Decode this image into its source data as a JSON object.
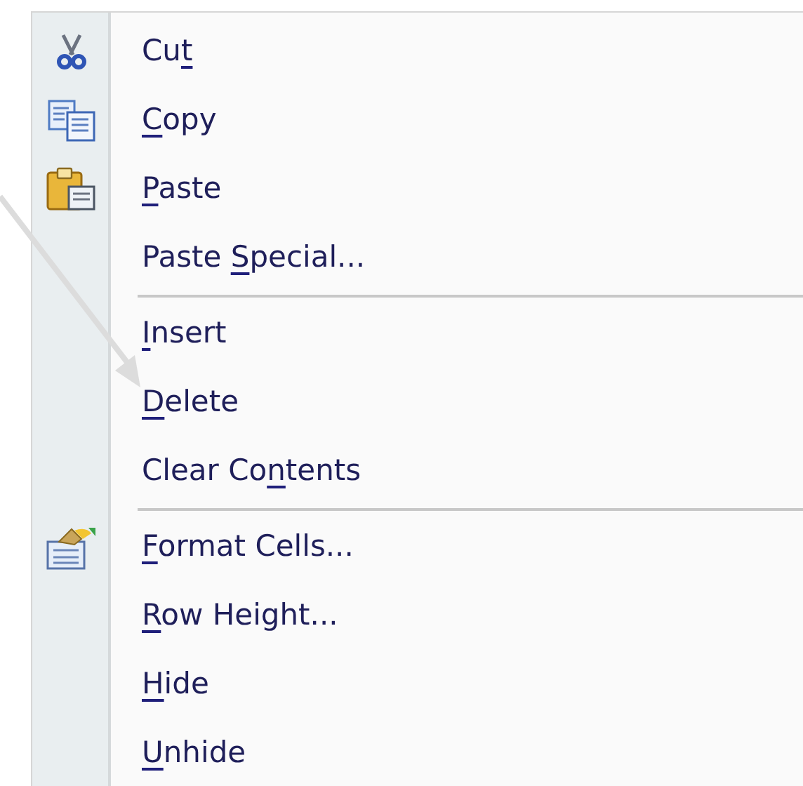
{
  "menu": {
    "items": [
      {
        "kind": "item",
        "pre": "Cu",
        "key": "t"
      },
      {
        "kind": "item",
        "key": "C",
        "post": "opy"
      },
      {
        "kind": "item",
        "key": "P",
        "post": "aste"
      },
      {
        "kind": "item",
        "pre": "Paste ",
        "key": "S",
        "post": "pecial..."
      },
      {
        "kind": "separator"
      },
      {
        "kind": "item",
        "key": "I",
        "post": "nsert"
      },
      {
        "kind": "item",
        "key": "D",
        "post": "elete"
      },
      {
        "kind": "item",
        "pre": "Clear Co",
        "key": "n",
        "post": "tents"
      },
      {
        "kind": "separator"
      },
      {
        "kind": "item",
        "key": "F",
        "post": "ormat Cells..."
      },
      {
        "kind": "item",
        "key": "R",
        "post": "ow Height..."
      },
      {
        "kind": "item",
        "key": "H",
        "post": "ide"
      },
      {
        "kind": "item",
        "key": "U",
        "post": "nhide"
      }
    ]
  }
}
